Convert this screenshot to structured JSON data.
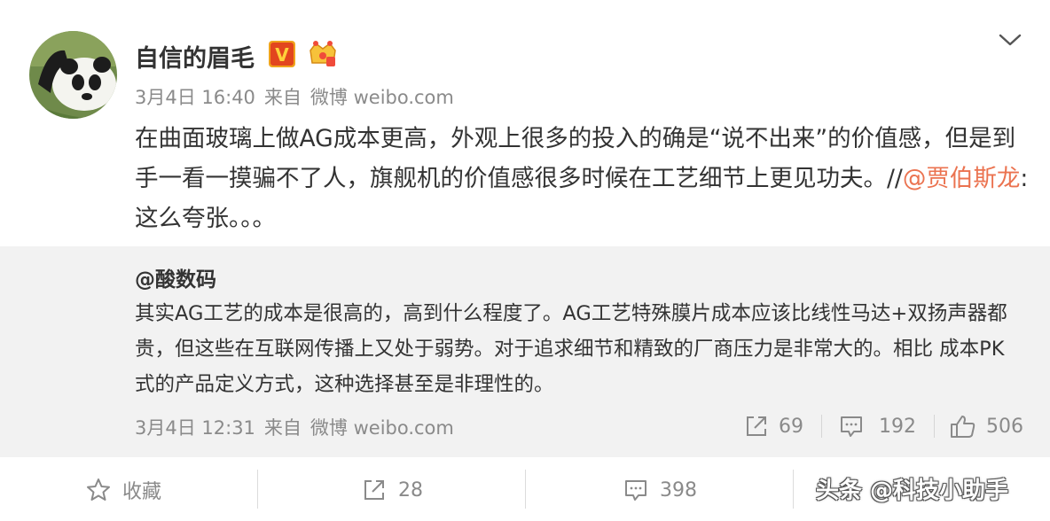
{
  "post": {
    "username": "自信的眉毛",
    "verified_badge_text": "V",
    "timestamp": "3月4日 16:40",
    "source_prefix": "来自",
    "source": "微博 weibo.com",
    "text_main": "在曲面玻璃上做AG成本更高，外观上很多的投入的确是“说不出来”的价值感，但是到手一看一摸骗不了人，旗舰机的价值感很多时候在工艺细节上更见功夫。//",
    "mention": "@贾伯斯龙",
    "text_tail": ": 这么夸张。。。",
    "icons": {
      "avatar": "panda-avatar",
      "verified": "verified-v-icon",
      "member": "crown-member-icon",
      "more": "chevron-down-icon"
    }
  },
  "repost": {
    "author": "@酸数码",
    "text": "其实AG工艺的成本是很高的，高到什么程度了。AG工艺特殊膜片成本应该比线性马达+双扬声器都贵，但这些在互联网传播上又处于弱势。对于追求细节和精致的厂商压力是非常大的。相比 成本PK式的产品定义方式，这种选择甚至是非理性的。",
    "timestamp": "3月4日 12:31",
    "source_prefix": "来自",
    "source": "微博 weibo.com",
    "shares": "69",
    "comments": "192",
    "likes": "506"
  },
  "actions": {
    "favorite_label": "收藏",
    "shares": "28",
    "comments": "398"
  },
  "watermark": "头条 @科技小助手",
  "colors": {
    "link": "#eb7350",
    "verified_badge": "#f0a31c",
    "repost_bg": "#f2f2f2",
    "meta_text": "#8a8a8a"
  }
}
